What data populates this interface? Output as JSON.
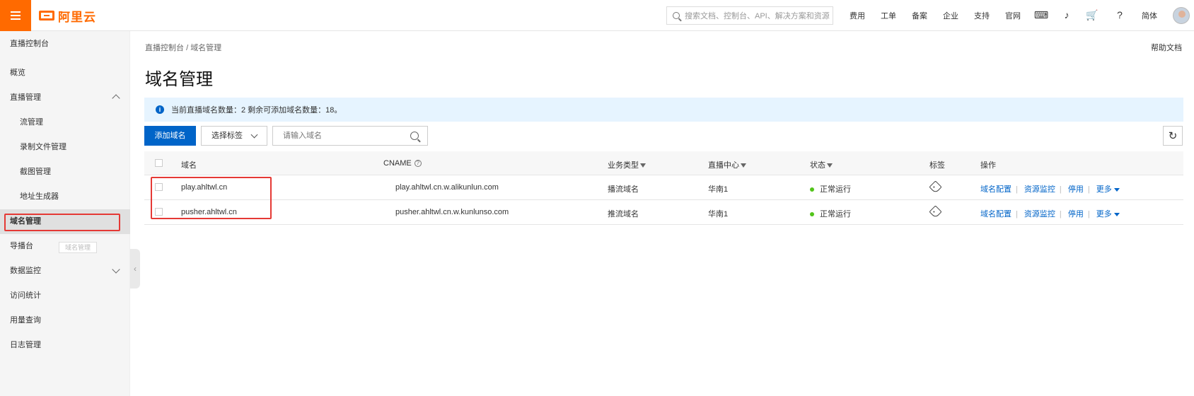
{
  "topbar": {
    "logo_text": "阿里云",
    "search_placeholder": "搜索文档、控制台、API、解决方案和资源",
    "nav": [
      "费用",
      "工单",
      "备案",
      "企业",
      "支持",
      "官网"
    ],
    "language": "简体"
  },
  "sidebar": {
    "title": "直播控制台",
    "items": [
      {
        "label": "概览",
        "level": 1
      },
      {
        "label": "直播管理",
        "level": 1,
        "expanded": true
      },
      {
        "label": "流管理",
        "level": 2
      },
      {
        "label": "录制文件管理",
        "level": 2
      },
      {
        "label": "截图管理",
        "level": 2
      },
      {
        "label": "地址生成器",
        "level": 2
      },
      {
        "label": "域名管理",
        "level": 1,
        "active": true
      },
      {
        "label": "导播台",
        "level": 1
      },
      {
        "label": "数据监控",
        "level": 1,
        "expanded": false
      },
      {
        "label": "访问统计",
        "level": 1
      },
      {
        "label": "用量查询",
        "level": 1
      },
      {
        "label": "日志管理",
        "level": 1
      }
    ],
    "tooltip": "域名管理"
  },
  "breadcrumb": {
    "root": "直播控制台",
    "separator": "/",
    "current": "域名管理"
  },
  "help_label": "帮助文档",
  "page_title": "域名管理",
  "notice": "当前直播域名数量：2 剩余可添加域名数量：18。",
  "toolbar": {
    "add_label": "添加域名",
    "tag_select": "选择标签",
    "search_placeholder": "请输入域名"
  },
  "table": {
    "columns": [
      "域名",
      "CNAME",
      "业务类型",
      "直播中心",
      "状态",
      "标签",
      "操作"
    ],
    "actions": [
      "域名配置",
      "资源监控",
      "停用",
      "更多"
    ],
    "rows": [
      {
        "domain": "play.ahltwl.cn",
        "cname": "play.ahltwl.cn.w.alikunlun.com",
        "type": "播流域名",
        "center": "华南1",
        "status": "正常运行"
      },
      {
        "domain": "pusher.ahltwl.cn",
        "cname": "pusher.ahltwl.cn.w.kunlunso.com",
        "type": "推流域名",
        "center": "华南1",
        "status": "正常运行"
      }
    ]
  },
  "colors": {
    "brand": "#ff6a00",
    "primary": "#0064c8",
    "running": "#52c41a",
    "highlight": "#e53935"
  }
}
